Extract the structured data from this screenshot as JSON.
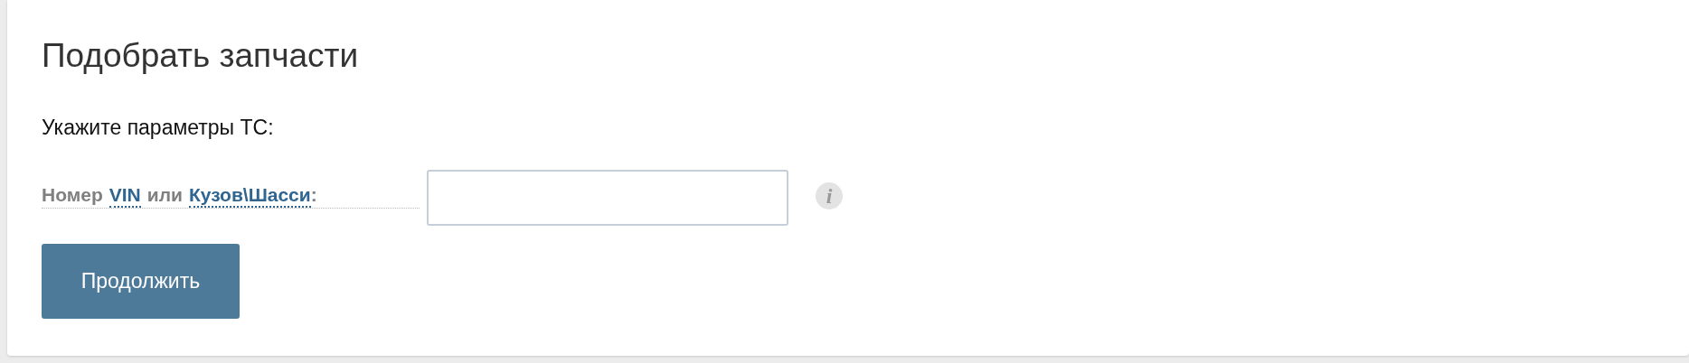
{
  "title": "Подобрать запчасти",
  "subtitle": "Укажите параметры ТС:",
  "field_label": {
    "prefix": "Номер",
    "vin_link": "VIN",
    "middle": "или",
    "body_link": "Кузов\\Шасси",
    "suffix": ":"
  },
  "info": {
    "glyph": "i"
  },
  "button": {
    "label": "Продолжить"
  }
}
